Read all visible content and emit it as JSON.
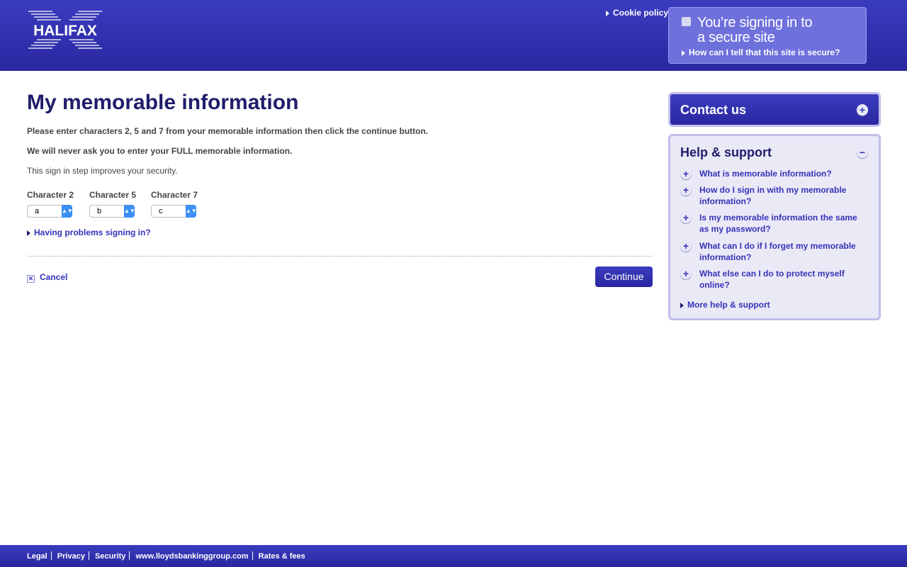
{
  "header": {
    "logo_text": "HALIFAX",
    "cookie_policy": "Cookie policy",
    "secure_title": "You’re signing in to a secure site",
    "secure_link": "How can I tell that this site is secure?"
  },
  "main": {
    "title": "My memorable information",
    "instruction": "Please enter characters 2, 5 and 7 from your memorable information then click the continue button.",
    "warning": "We will never ask you to enter your FULL memorable information.",
    "note": "This sign in step improves your security.",
    "characters": [
      {
        "label": "Character 2",
        "value": "a"
      },
      {
        "label": "Character 5",
        "value": "b"
      },
      {
        "label": "Character 7",
        "value": "c"
      }
    ],
    "problems_link": "Having problems signing in?",
    "cancel": "Cancel",
    "continue": "Continue"
  },
  "sidebar": {
    "contact": "Contact us",
    "help_title": "Help & support",
    "items": [
      "What is memorable information?",
      "How do I sign in with my memorable information?",
      "Is my memorable information the same as my password?",
      "What can I do if I forget my memorable information?",
      "What else can I do to protect myself online?"
    ],
    "more": "More help & support"
  },
  "footer": {
    "links": [
      "Legal",
      "Privacy",
      "Security",
      "www.lloydsbankinggroup.com",
      "Rates & fees"
    ]
  },
  "colors": {
    "brand": "#2f2db0",
    "heading": "#1f1d6b",
    "link": "#3533b8"
  }
}
